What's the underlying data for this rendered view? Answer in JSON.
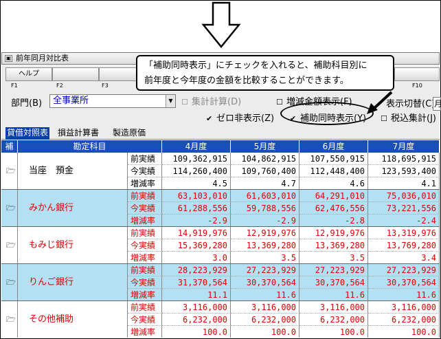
{
  "window": {
    "title": "前年同月対比表"
  },
  "fkeys": [
    {
      "key": "F1",
      "label": "ヘルプ"
    },
    {
      "key": "F2",
      "label": ""
    },
    {
      "key": "F3",
      "label": ""
    },
    {
      "key": "F10",
      "label": ""
    }
  ],
  "options": {
    "dept_label": "部門(B)",
    "dept_value": "全事業所",
    "partial1": "集計計算(D)",
    "partial2": "増減金額表示(F)",
    "partial3": "表示切替(C)",
    "zero_hide": "ゼロ非表示(Z)",
    "aux_show": "補助同時表示(Y)",
    "tax_incl": "税込集計(J)",
    "switch_value": "月"
  },
  "tabs": [
    "貸借対照表",
    "損益計算書",
    "製造原価"
  ],
  "table": {
    "headers": {
      "aux": "補",
      "account": "勘定科目",
      "months": [
        "4月度",
        "5月度",
        "6月度",
        "7月度"
      ]
    },
    "kinds": [
      "前実績",
      "今実績",
      "増減率"
    ],
    "rows": [
      {
        "name": "当座　預金",
        "style": "white",
        "prev": [
          "109,362,915",
          "104,862,915",
          "107,550,915",
          "118,695,915"
        ],
        "curr": [
          "114,260,400",
          "109,760,400",
          "112,448,400",
          "123,593,400"
        ],
        "rate": [
          "4.5",
          "4.7",
          "4.6",
          "4.1"
        ]
      },
      {
        "name": "みかん銀行",
        "style": "blue",
        "prev": [
          "63,103,010",
          "61,603,010",
          "64,291,010",
          "75,036,010"
        ],
        "curr": [
          "61,288,556",
          "59,788,556",
          "62,476,556",
          "73,221,556"
        ],
        "rate": [
          "-2.9",
          "-2.9",
          "-2.8",
          "-2.4"
        ]
      },
      {
        "name": "もみじ銀行",
        "style": "white",
        "prev": [
          "14,919,976",
          "12,919,976",
          "12,919,976",
          "13,319,976"
        ],
        "curr": [
          "15,369,280",
          "13,369,280",
          "13,369,280",
          "13,769,280"
        ],
        "rate": [
          "3.0",
          "3.5",
          "3.5",
          "3.4"
        ]
      },
      {
        "name": "りんご銀行",
        "style": "blue",
        "prev": [
          "28,223,929",
          "27,223,929",
          "27,223,929",
          "27,223,929"
        ],
        "curr": [
          "31,370,564",
          "30,370,564",
          "30,370,564",
          "30,370,564"
        ],
        "rate": [
          "11.1",
          "11.6",
          "11.6",
          "11.6"
        ]
      },
      {
        "name": "その他補助",
        "style": "white",
        "prev": [
          "3,116,000",
          "3,116,000",
          "3,116,000",
          "3,116,000"
        ],
        "curr": [
          "6,232,000",
          "6,232,000",
          "6,232,000",
          "6,232,000"
        ],
        "rate": [
          "100.0",
          "100.0",
          "100.0",
          "100.0"
        ]
      }
    ]
  },
  "callout": {
    "line1": "「補助同時表示」にチェックを入れると、補助科目別に",
    "line2": "前年度と今年度の金額を比較することができます。"
  },
  "colors": {
    "header": "#1b4fb8",
    "blue_row": "#b3e0f2",
    "red_text": "#e00000"
  }
}
